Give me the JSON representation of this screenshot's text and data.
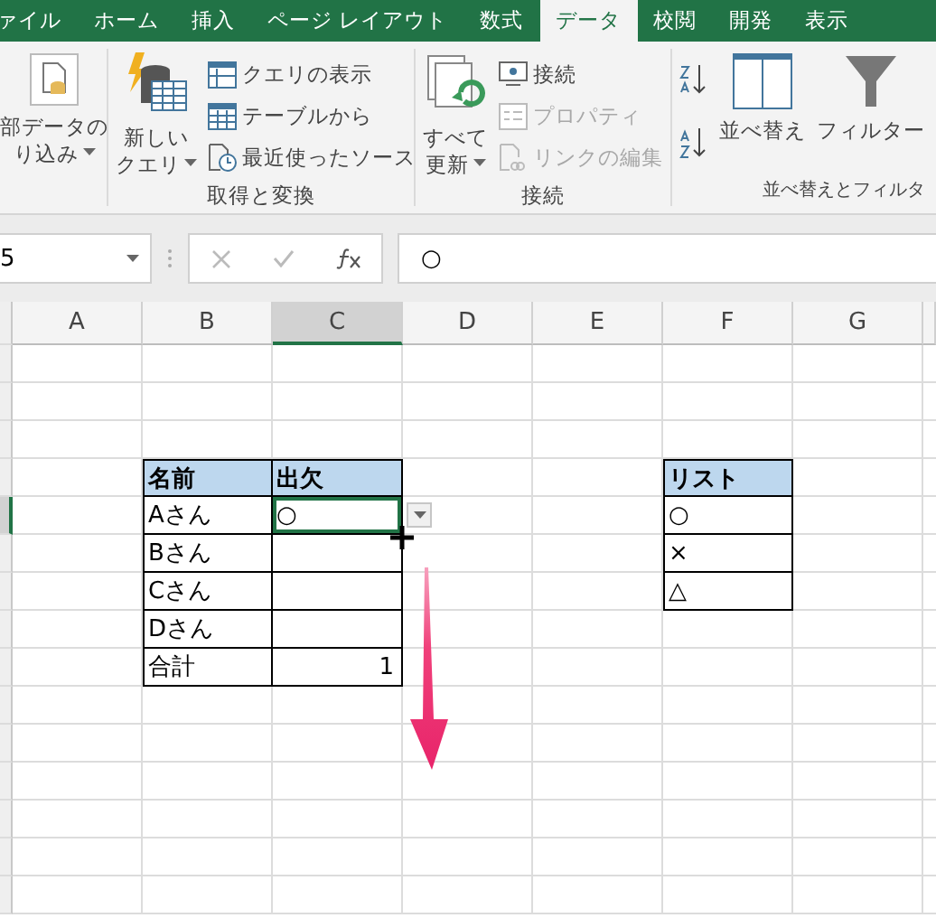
{
  "tabs": [
    {
      "label": "ァイル",
      "selected": false
    },
    {
      "label": "ホーム",
      "selected": false
    },
    {
      "label": "挿入",
      "selected": false
    },
    {
      "label": "ページ レイアウト",
      "selected": false
    },
    {
      "label": "数式",
      "selected": false
    },
    {
      "label": "データ",
      "selected": true
    },
    {
      "label": "校閲",
      "selected": false
    },
    {
      "label": "開発",
      "selected": false
    },
    {
      "label": "表示",
      "selected": false
    }
  ],
  "ribbon": {
    "groups": [
      {
        "items": [
          {
            "kind": "large",
            "lines": [
              "部データの",
              "り込み"
            ],
            "dropdown": true
          }
        ]
      },
      {
        "label": "取得と変換",
        "items": [
          {
            "kind": "large",
            "lines": [
              "新しい",
              "クエリ"
            ],
            "dropdown": true
          },
          {
            "kind": "stack",
            "entries": [
              {
                "label": "クエリの表示",
                "disabled": false
              },
              {
                "label": "テーブルから",
                "disabled": false
              },
              {
                "label": "最近使ったソース",
                "disabled": false
              }
            ]
          }
        ]
      },
      {
        "label": "接続",
        "items": [
          {
            "kind": "large",
            "lines": [
              "すべて",
              "更新"
            ],
            "dropdown": true
          },
          {
            "kind": "stack",
            "entries": [
              {
                "label": "接続",
                "disabled": false
              },
              {
                "label": "プロパティ",
                "disabled": true
              },
              {
                "label": "リンクの編集",
                "disabled": true
              }
            ]
          }
        ]
      },
      {
        "label": "並べ替えとフィルタ",
        "items": [
          {
            "kind": "sort"
          },
          {
            "kind": "large",
            "lines": [
              "並べ替え"
            ],
            "dropdown": false
          },
          {
            "kind": "large",
            "lines": [
              "フィルター"
            ],
            "dropdown": false
          }
        ]
      }
    ]
  },
  "formula_bar": {
    "name_box": "5",
    "formula": "○"
  },
  "sheet": {
    "columns": [
      {
        "label": "A",
        "selected": false
      },
      {
        "label": "B",
        "selected": false
      },
      {
        "label": "C",
        "selected": true
      },
      {
        "label": "D",
        "selected": false
      },
      {
        "label": "E",
        "selected": false
      },
      {
        "label": "F",
        "selected": false
      },
      {
        "label": "G",
        "selected": false
      }
    ],
    "table_1": {
      "columns": [
        "名前",
        "出欠"
      ],
      "rows": [
        {
          "label": "Aさん",
          "value": "○",
          "kind": "text",
          "selected": true
        },
        {
          "label": "Bさん",
          "kind": "text",
          "selected": false
        },
        {
          "label": "Cさん",
          "kind": "text",
          "selected": false
        },
        {
          "label": "Dさん",
          "kind": "text",
          "selected": false
        },
        {
          "label": "合計",
          "value": "1",
          "kind": "number",
          "selected": false
        }
      ]
    },
    "table_2": {
      "column": "リスト",
      "rows": [
        "○",
        "×",
        "△"
      ]
    }
  }
}
